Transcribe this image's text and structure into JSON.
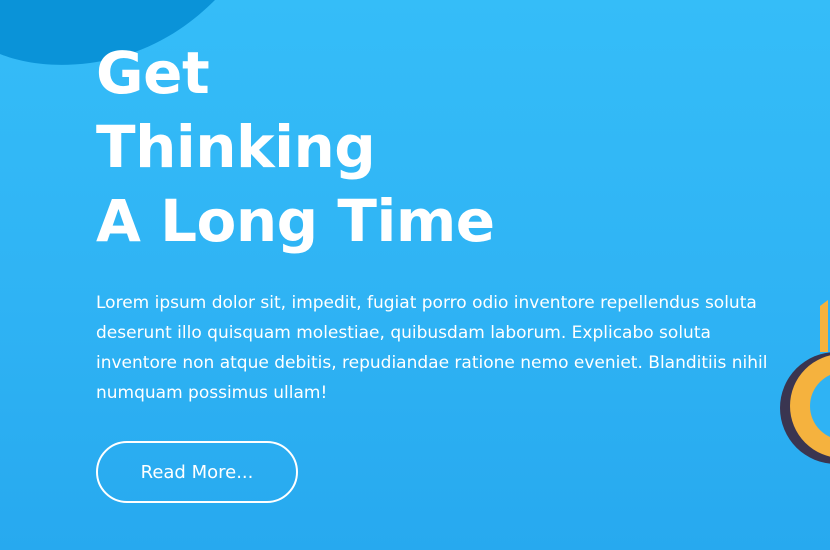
{
  "hero": {
    "title_lines": [
      "Get",
      "Thinking",
      "A Long Time"
    ],
    "description": "Lorem ipsum dolor sit, impedit, fugiat porro odio inventore repellendus soluta deserunt illo quisquam molestiae, quibusdam laborum. Explicabo soluta inventore non atque debitis, repudiandae ratione nemo eveniet. Blanditiis nihil numquam possimus ullam!",
    "button_label": "Read More..."
  },
  "colors": {
    "background": "#33b8f6",
    "blob": "#0a93d8",
    "ring_outer": "#3a3550",
    "ring_inner": "#f5b23e"
  },
  "icons": [
    "decorative-blob-icon",
    "decorative-ring-icon"
  ]
}
